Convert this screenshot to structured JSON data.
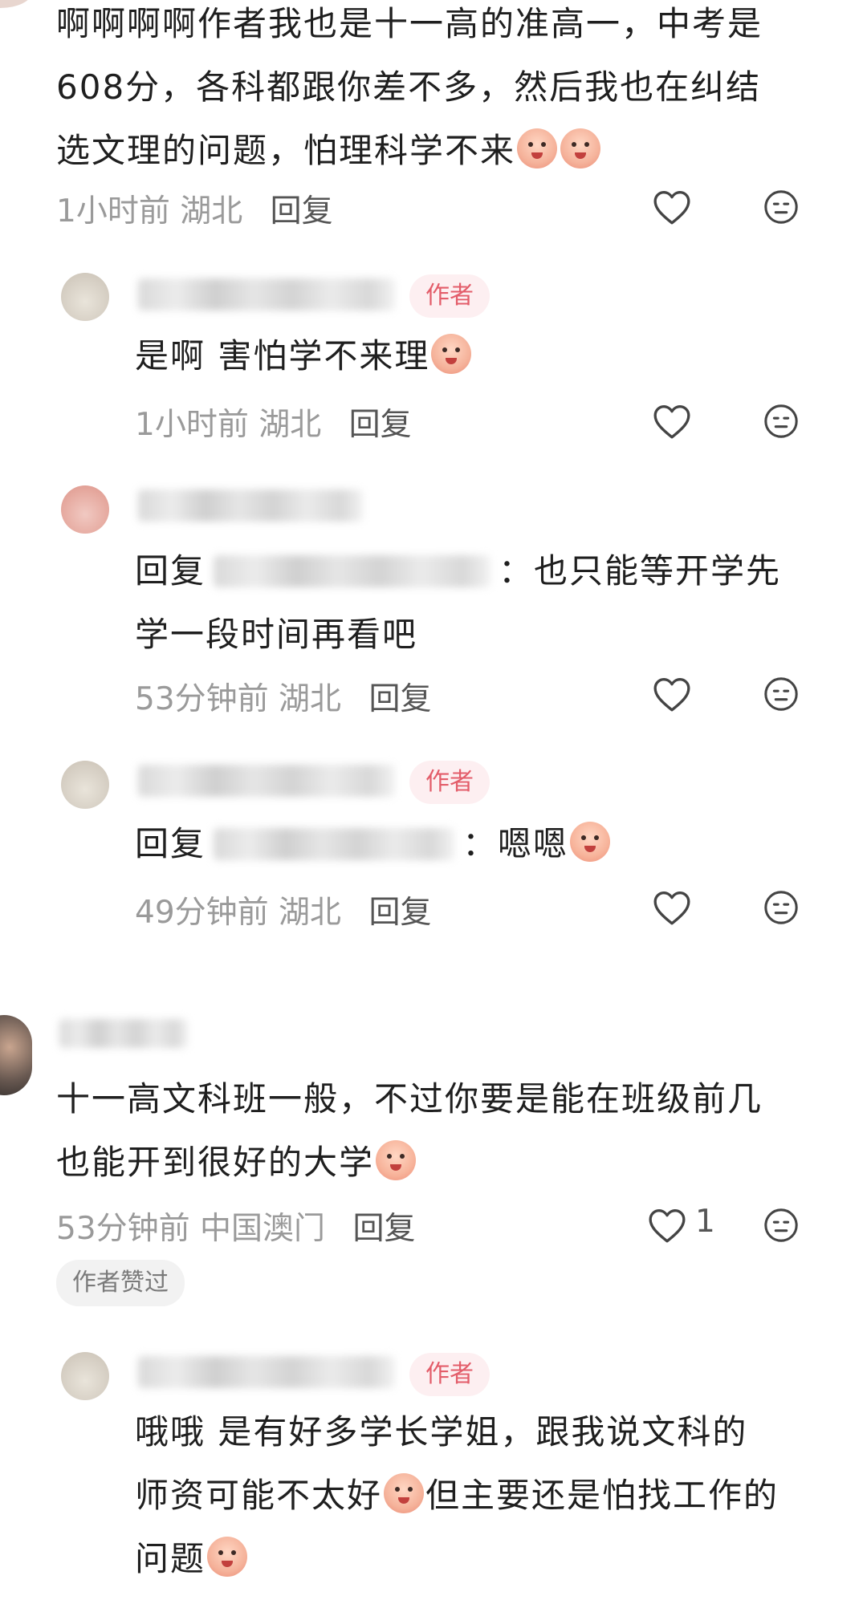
{
  "comments": {
    "c1": {
      "text_line1": "啊啊啊啊作者我也是十一高的准高一，中考是",
      "text_line2": "608分，各科都跟你差不多，然后我也在纠结",
      "text_line3": "选文理的问题，怕理科学不来",
      "time": "1小时前",
      "location": "湖北",
      "reply_label": "回复"
    },
    "r1": {
      "author_tag": "作者",
      "text": "是啊 害怕学不来理",
      "time": "1小时前",
      "location": "湖北",
      "reply_label": "回复"
    },
    "r2": {
      "reply_prefix": "回复",
      "text_line1": "：也只能等开学先",
      "text_line2": "学一段时间再看吧",
      "time": "53分钟前",
      "location": "湖北",
      "reply_label": "回复"
    },
    "r3": {
      "author_tag": "作者",
      "reply_prefix": "回复",
      "text": "：嗯嗯",
      "time": "49分钟前",
      "location": "湖北",
      "reply_label": "回复"
    },
    "c2": {
      "text_line1": "十一高文科班一般，不过你要是能在班级前几",
      "text_line2": "也能开到很好的大学",
      "time": "53分钟前",
      "location": "中国澳门",
      "reply_label": "回复",
      "like_count": "1",
      "liked_tag": "作者赞过"
    },
    "r4": {
      "author_tag": "作者",
      "text_line1": "哦哦 是有好多学长学姐，跟我说文科的",
      "text_line2": "师资可能不太好",
      "text_line2b": "但主要还是怕找工作的",
      "text_line3": "问题"
    }
  },
  "icons": {
    "like": "heart-outline-icon",
    "dislike": "meh-face-icon",
    "emoji_cry": "crying-face-emoji",
    "emoji_blush": "blushing-face-emoji"
  },
  "colors": {
    "author_tag_bg": "#fdeff1",
    "author_tag_text": "#e35d6a",
    "meta_gray": "#9a9a9a"
  }
}
